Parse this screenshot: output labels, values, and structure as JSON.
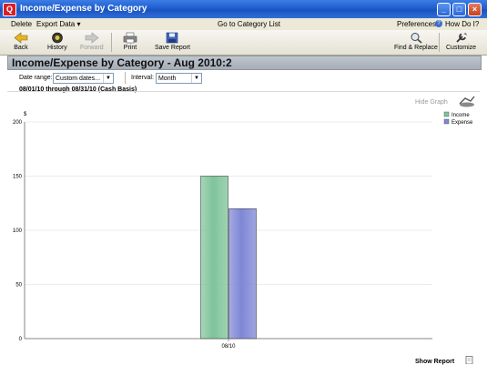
{
  "window": {
    "title": "Income/Expense by Category",
    "app_icon": "Q"
  },
  "menu": {
    "delete": "Delete",
    "export": "Export Data ▾",
    "goto": "Go to Category List",
    "preferences": "Preferences",
    "howdoi": "How Do I?"
  },
  "toolbar": {
    "back": "Back",
    "history": "History",
    "forward": "Forward",
    "print": "Print",
    "save_report": "Save Report",
    "find_replace": "Find & Replace",
    "customize": "Customize"
  },
  "report": {
    "title": "Income/Expense by Category - Aug 2010:2",
    "date_range_label": "Date range:",
    "date_range_value": "Custom dates...",
    "interval_label": "Interval:",
    "interval_value": "Month",
    "period": "08/01/10 through 08/31/10 (Cash Basis)"
  },
  "graph": {
    "hide_graph": "Hide Graph",
    "show_report": "Show Report"
  },
  "chart_data": {
    "type": "bar",
    "categories": [
      "08/10"
    ],
    "series": [
      {
        "name": "Income",
        "values": [
          150
        ],
        "color": "#7fc49a"
      },
      {
        "name": "Expense",
        "values": [
          120
        ],
        "color": "#7f87d6"
      }
    ],
    "ylabel": "$",
    "ylim": [
      0,
      200
    ],
    "yticks": [
      "0",
      "50",
      "100",
      "150",
      "200"
    ],
    "grid": true,
    "legend": "top-right"
  }
}
